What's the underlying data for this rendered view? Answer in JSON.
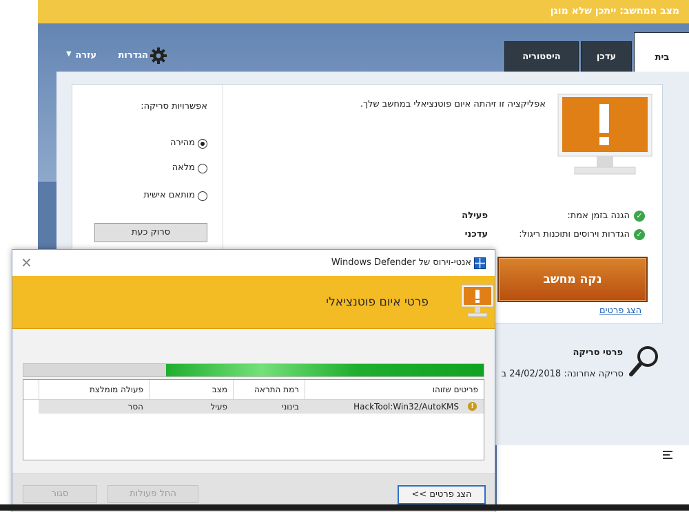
{
  "main": {
    "title": "מצב המחשב: ייתכן שלא מוגן",
    "tabs": [
      {
        "label": "בית"
      },
      {
        "label": "עדכן"
      },
      {
        "label": "היסטוריה"
      }
    ],
    "settings_label": "הגדרות",
    "help_label": "עזרה",
    "alert_text": "אפליקציה זו זיהתה איום פוטנציאלי במחשב שלך.",
    "status_rows": [
      {
        "label": "הגנה בזמן אמת:",
        "value": "פעילה"
      },
      {
        "label": "הגדרות וירוסים ותוכנות ריגול:",
        "value": "עדכני"
      }
    ],
    "clean_button": "נקה מחשב",
    "details_link": "הצג פרטים",
    "scan_options_title": "אפשרויות סריקה:",
    "scan_options": [
      {
        "label": "מהירה",
        "selected": true
      },
      {
        "label": "מלאה",
        "selected": false
      },
      {
        "label": "מותאם אישית",
        "selected": false
      }
    ],
    "scan_now_button": "סרוק כעת",
    "scan_details_title": "פרטי סריקה",
    "last_scan": "סריקה אחרונה: 24/02/2018 ב"
  },
  "dialog": {
    "title": "אנטי-וירוס של Windows Defender",
    "heading": "פרטי איום פוטנציאלי",
    "progress_fraction": 0.69,
    "columns": [
      "פריטים שזוהו",
      "רמת התראה",
      "מצב",
      "פעולה מומלצת"
    ],
    "rows": [
      {
        "item": "HackTool:Win32/AutoKMS",
        "level": "בינוני",
        "status": "פעיל",
        "action": "הסר"
      }
    ],
    "show_details_button": "הצג פרטים >>",
    "apply_button": "החל פעולות",
    "close_button": "סגור"
  },
  "colors": {
    "title_bar": "#f2c744",
    "tab_dark": "#2f3a44",
    "clean_button": "#c9661d",
    "banner": "#f3bb24",
    "progress": "#1fae2e"
  }
}
